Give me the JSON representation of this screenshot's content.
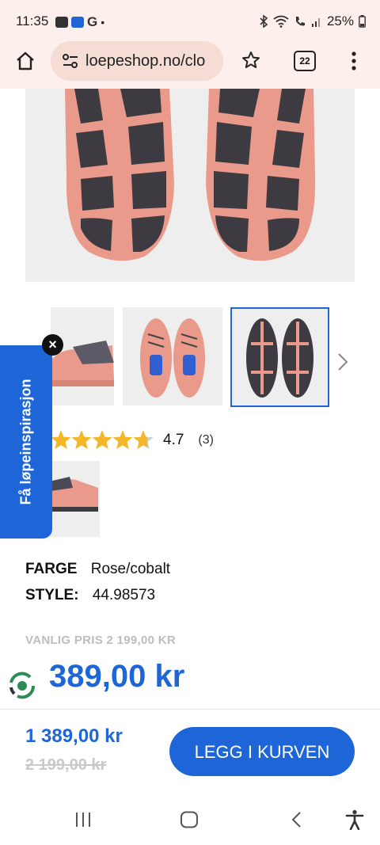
{
  "status_bar": {
    "time": "11:35",
    "network_icons": [
      "gallery-icon",
      "app-icon",
      "google-icon",
      "dot-icon"
    ],
    "battery": "25%"
  },
  "browser": {
    "url": "loepeshop.no/clo",
    "tab_count": "22"
  },
  "product": {
    "rating": {
      "value": "4.7",
      "count": "(3)",
      "stars": 4.7
    },
    "color_label": "FARGE",
    "color_value": "Rose/cobalt",
    "style_label": "STYLE:",
    "style_value": "44.98573",
    "list_price": "VANLIG PRIS 2 199,00 KR",
    "price": "389,00 kr"
  },
  "side_tab": {
    "label": "Få løpeinspirasjon"
  },
  "cart_bar": {
    "price": "1 389,00 kr",
    "old_price": "2 199,00 kr",
    "button_label": "LEGG I KURVEN"
  },
  "colors": {
    "accent": "#1e66d8",
    "shoe_pink": "#e99a8a",
    "sole_dark": "#3d3a42",
    "star": "#f5b72a"
  }
}
